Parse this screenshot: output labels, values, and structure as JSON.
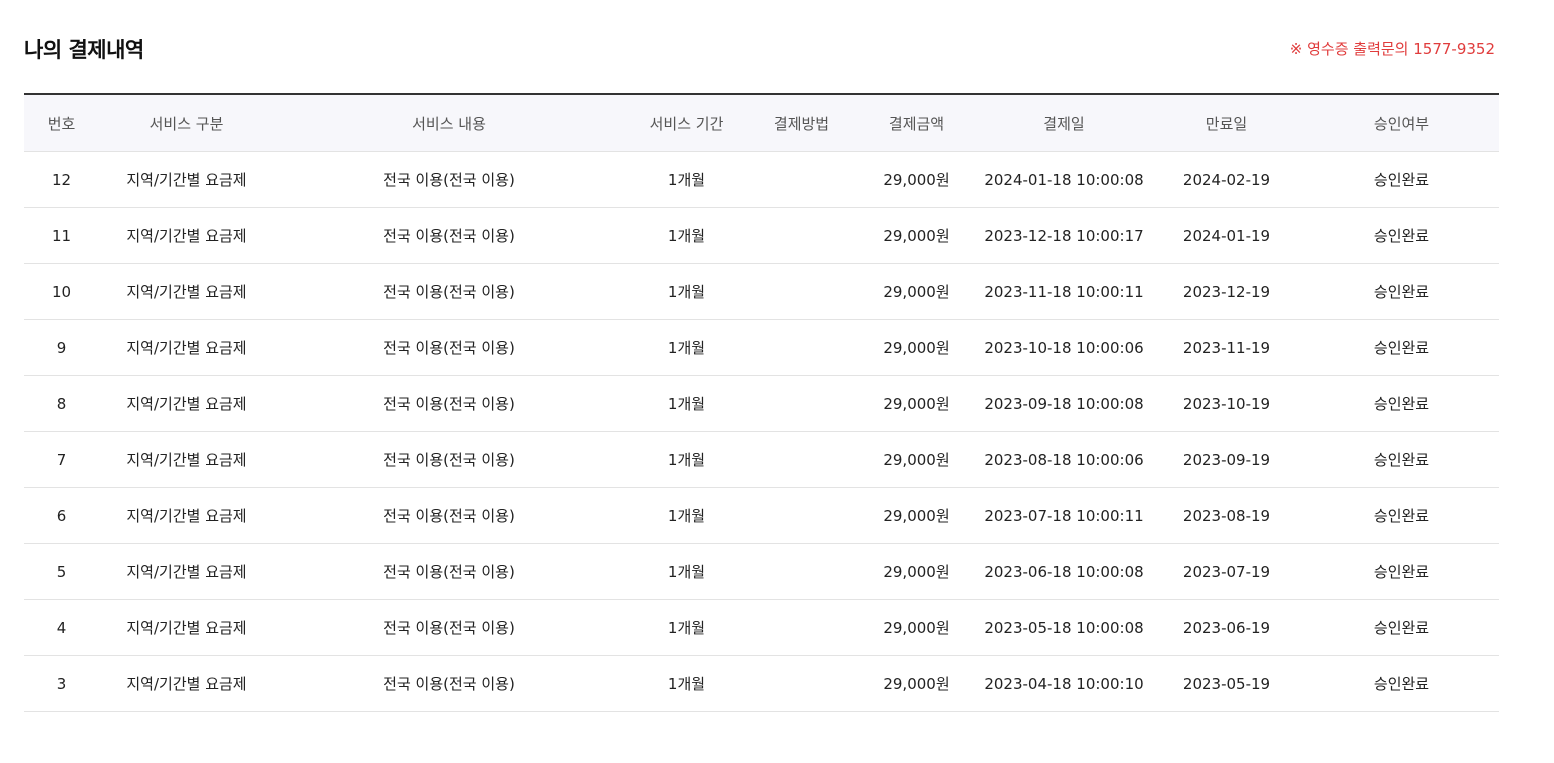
{
  "page": {
    "title": "나의 결제내역",
    "receipt_notice": "※ 영수증 출력문의 1577-9352"
  },
  "colors": {
    "notice": "#e03c3c",
    "header_bg": "#f7f7fb",
    "top_border": "#333333",
    "row_border": "#e3e3e3"
  },
  "table": {
    "columns": [
      "번호",
      "서비스 구분",
      "서비스 내용",
      "서비스 기간",
      "결제방법",
      "결제금액",
      "결제일",
      "만료일",
      "승인여부"
    ],
    "rows": [
      {
        "no": "12",
        "service_type": "지역/기간별 요금제",
        "service_content": "전국 이용(전국 이용)",
        "period": "1개월",
        "method": "",
        "amount": "29,000원",
        "paid_at": "2024-01-18 10:00:08",
        "expires": "2024-02-19",
        "status": "승인완료"
      },
      {
        "no": "11",
        "service_type": "지역/기간별 요금제",
        "service_content": "전국 이용(전국 이용)",
        "period": "1개월",
        "method": "",
        "amount": "29,000원",
        "paid_at": "2023-12-18 10:00:17",
        "expires": "2024-01-19",
        "status": "승인완료"
      },
      {
        "no": "10",
        "service_type": "지역/기간별 요금제",
        "service_content": "전국 이용(전국 이용)",
        "period": "1개월",
        "method": "",
        "amount": "29,000원",
        "paid_at": "2023-11-18 10:00:11",
        "expires": "2023-12-19",
        "status": "승인완료"
      },
      {
        "no": "9",
        "service_type": "지역/기간별 요금제",
        "service_content": "전국 이용(전국 이용)",
        "period": "1개월",
        "method": "",
        "amount": "29,000원",
        "paid_at": "2023-10-18 10:00:06",
        "expires": "2023-11-19",
        "status": "승인완료"
      },
      {
        "no": "8",
        "service_type": "지역/기간별 요금제",
        "service_content": "전국 이용(전국 이용)",
        "period": "1개월",
        "method": "",
        "amount": "29,000원",
        "paid_at": "2023-09-18 10:00:08",
        "expires": "2023-10-19",
        "status": "승인완료"
      },
      {
        "no": "7",
        "service_type": "지역/기간별 요금제",
        "service_content": "전국 이용(전국 이용)",
        "period": "1개월",
        "method": "",
        "amount": "29,000원",
        "paid_at": "2023-08-18 10:00:06",
        "expires": "2023-09-19",
        "status": "승인완료"
      },
      {
        "no": "6",
        "service_type": "지역/기간별 요금제",
        "service_content": "전국 이용(전국 이용)",
        "period": "1개월",
        "method": "",
        "amount": "29,000원",
        "paid_at": "2023-07-18 10:00:11",
        "expires": "2023-08-19",
        "status": "승인완료"
      },
      {
        "no": "5",
        "service_type": "지역/기간별 요금제",
        "service_content": "전국 이용(전국 이용)",
        "period": "1개월",
        "method": "",
        "amount": "29,000원",
        "paid_at": "2023-06-18 10:00:08",
        "expires": "2023-07-19",
        "status": "승인완료"
      },
      {
        "no": "4",
        "service_type": "지역/기간별 요금제",
        "service_content": "전국 이용(전국 이용)",
        "period": "1개월",
        "method": "",
        "amount": "29,000원",
        "paid_at": "2023-05-18 10:00:08",
        "expires": "2023-06-19",
        "status": "승인완료"
      },
      {
        "no": "3",
        "service_type": "지역/기간별 요금제",
        "service_content": "전국 이용(전국 이용)",
        "period": "1개월",
        "method": "",
        "amount": "29,000원",
        "paid_at": "2023-04-18 10:00:10",
        "expires": "2023-05-19",
        "status": "승인완료"
      }
    ]
  }
}
